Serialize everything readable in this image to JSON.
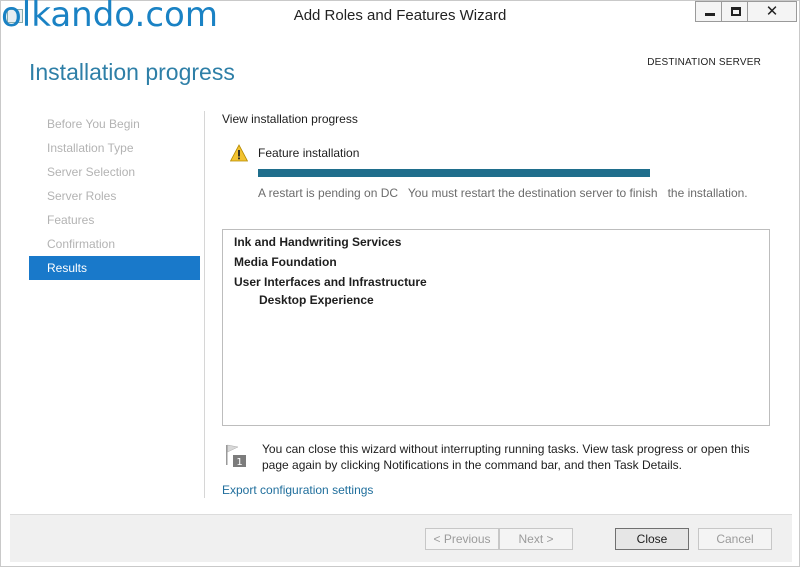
{
  "watermark": "olkando.com",
  "window": {
    "title": "Add Roles and Features Wizard",
    "minimize_icon": "minimize-icon",
    "maximize_icon": "maximize-icon",
    "close_glyph": "✕"
  },
  "header": {
    "title": "Installation progress",
    "destination_server": "DESTINATION SERVER"
  },
  "nav": {
    "items": [
      {
        "label": "Before You Begin",
        "active": false
      },
      {
        "label": "Installation Type",
        "active": false
      },
      {
        "label": "Server Selection",
        "active": false
      },
      {
        "label": "Server Roles",
        "active": false
      },
      {
        "label": "Features",
        "active": false
      },
      {
        "label": "Confirmation",
        "active": false
      },
      {
        "label": "Results",
        "active": true
      }
    ]
  },
  "main": {
    "heading": "View installation progress",
    "feature_label": "Feature installation",
    "progress_fraction": 1.0,
    "restart_message_part1": "A restart is pending on DC",
    "restart_message_part2": "You must restart the destination server to finish",
    "restart_message_part3": "the installation.",
    "results": [
      {
        "text": "Ink and Handwriting Services",
        "indent": 0
      },
      {
        "text": "Media Foundation",
        "indent": 0
      },
      {
        "text": "User Interfaces and Infrastructure",
        "indent": 0
      },
      {
        "text": "Desktop Experience",
        "indent": 1
      }
    ],
    "note": "You can close this wizard without interrupting running tasks. View task progress or open this page again by clicking Notifications in the command bar, and then Task Details.",
    "export_link": "Export configuration settings"
  },
  "footer": {
    "previous": "< Previous",
    "next": "Next >",
    "close": "Close",
    "cancel": "Cancel"
  },
  "colors": {
    "accent": "#1979ca",
    "title": "#2e7fa7",
    "progress": "#1f6e8c",
    "watermark": "#1a82c4"
  }
}
